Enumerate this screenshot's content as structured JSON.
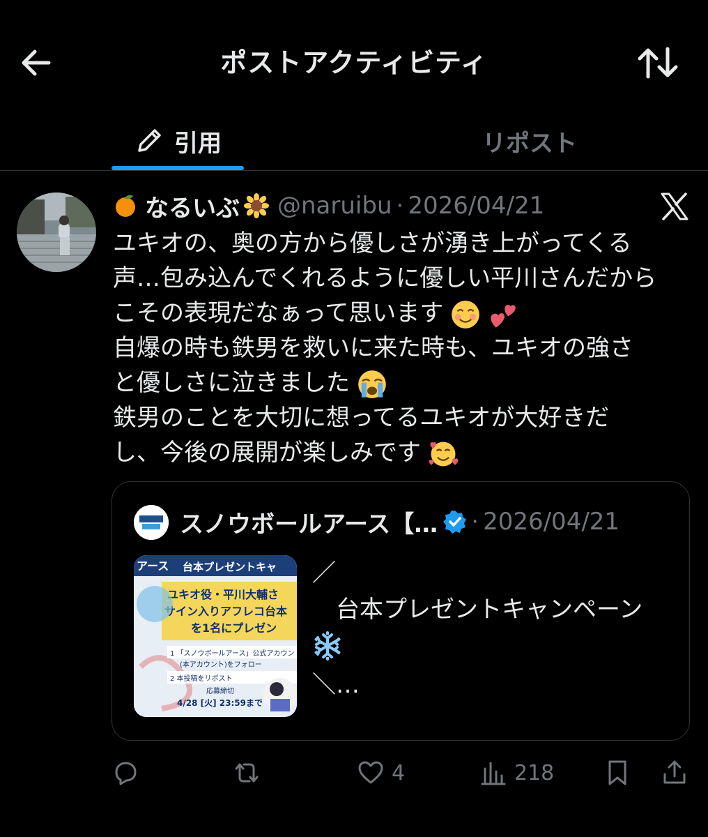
{
  "header": {
    "title": "ポストアクティビティ",
    "back_icon": "arrow-left-icon",
    "sort_icon": "sort-arrows-icon"
  },
  "tabs": [
    {
      "label": "引用",
      "icon": "pencil-icon",
      "active": true
    },
    {
      "label": "リポスト",
      "active": false
    }
  ],
  "post": {
    "name": "なるいぶ",
    "name_emoji_before": "tangerine-emoji",
    "name_emoji_after": "sunflower-emoji",
    "handle": "@naruibu",
    "separator": "·",
    "date": "2026/04/21",
    "source_icon": "x-logo-icon",
    "lines": [
      "ユキオの、奥の方から優しさが湧き上がってくる",
      "声…包み込んでくれるように優しい平川さんだから",
      "こその表現だなぁって思います",
      "自爆の時も鉄男を救いに来た時も、ユキオの強さ",
      "と優しさに泣きました",
      "鉄男のことを大切に想ってるユキオが大好きだ",
      "し、今後の展開が楽しみです"
    ]
  },
  "quoted": {
    "name": "スノウボールアース【…",
    "separator": "·",
    "date": "2026/04/21",
    "verified_icon": "verified-badge-icon",
    "text_lines": [
      "／",
      "　台本プレゼントキャンペーン",
      "",
      "＼…"
    ],
    "image": {
      "logo": "アース",
      "header": "台本プレゼントキャ",
      "headline1": "ユキオ役・平川大輔さ",
      "headline2": "サイン入りアフレコ台本",
      "headline3": "を1名にプレゼン",
      "step1a": "1 「スノウボールアース」公式アカウン",
      "step1b": "(本アカウント)をフォロー",
      "step2": "2 本投稿をリポスト",
      "deadline_label": "応募締切",
      "deadline": "4/28 [火] 23:59まで"
    }
  },
  "actions": {
    "reply_icon": "reply-icon",
    "repost_icon": "repost-icon",
    "like_icon": "heart-icon",
    "likes": "4",
    "views_icon": "views-chart-icon",
    "views": "218",
    "bookmark_icon": "bookmark-icon",
    "share_icon": "share-icon"
  },
  "colors": {
    "background": "#000000",
    "text": "#e7e9ea",
    "muted": "#71767b",
    "accent": "#1d9bf0",
    "border": "#2f3336"
  }
}
